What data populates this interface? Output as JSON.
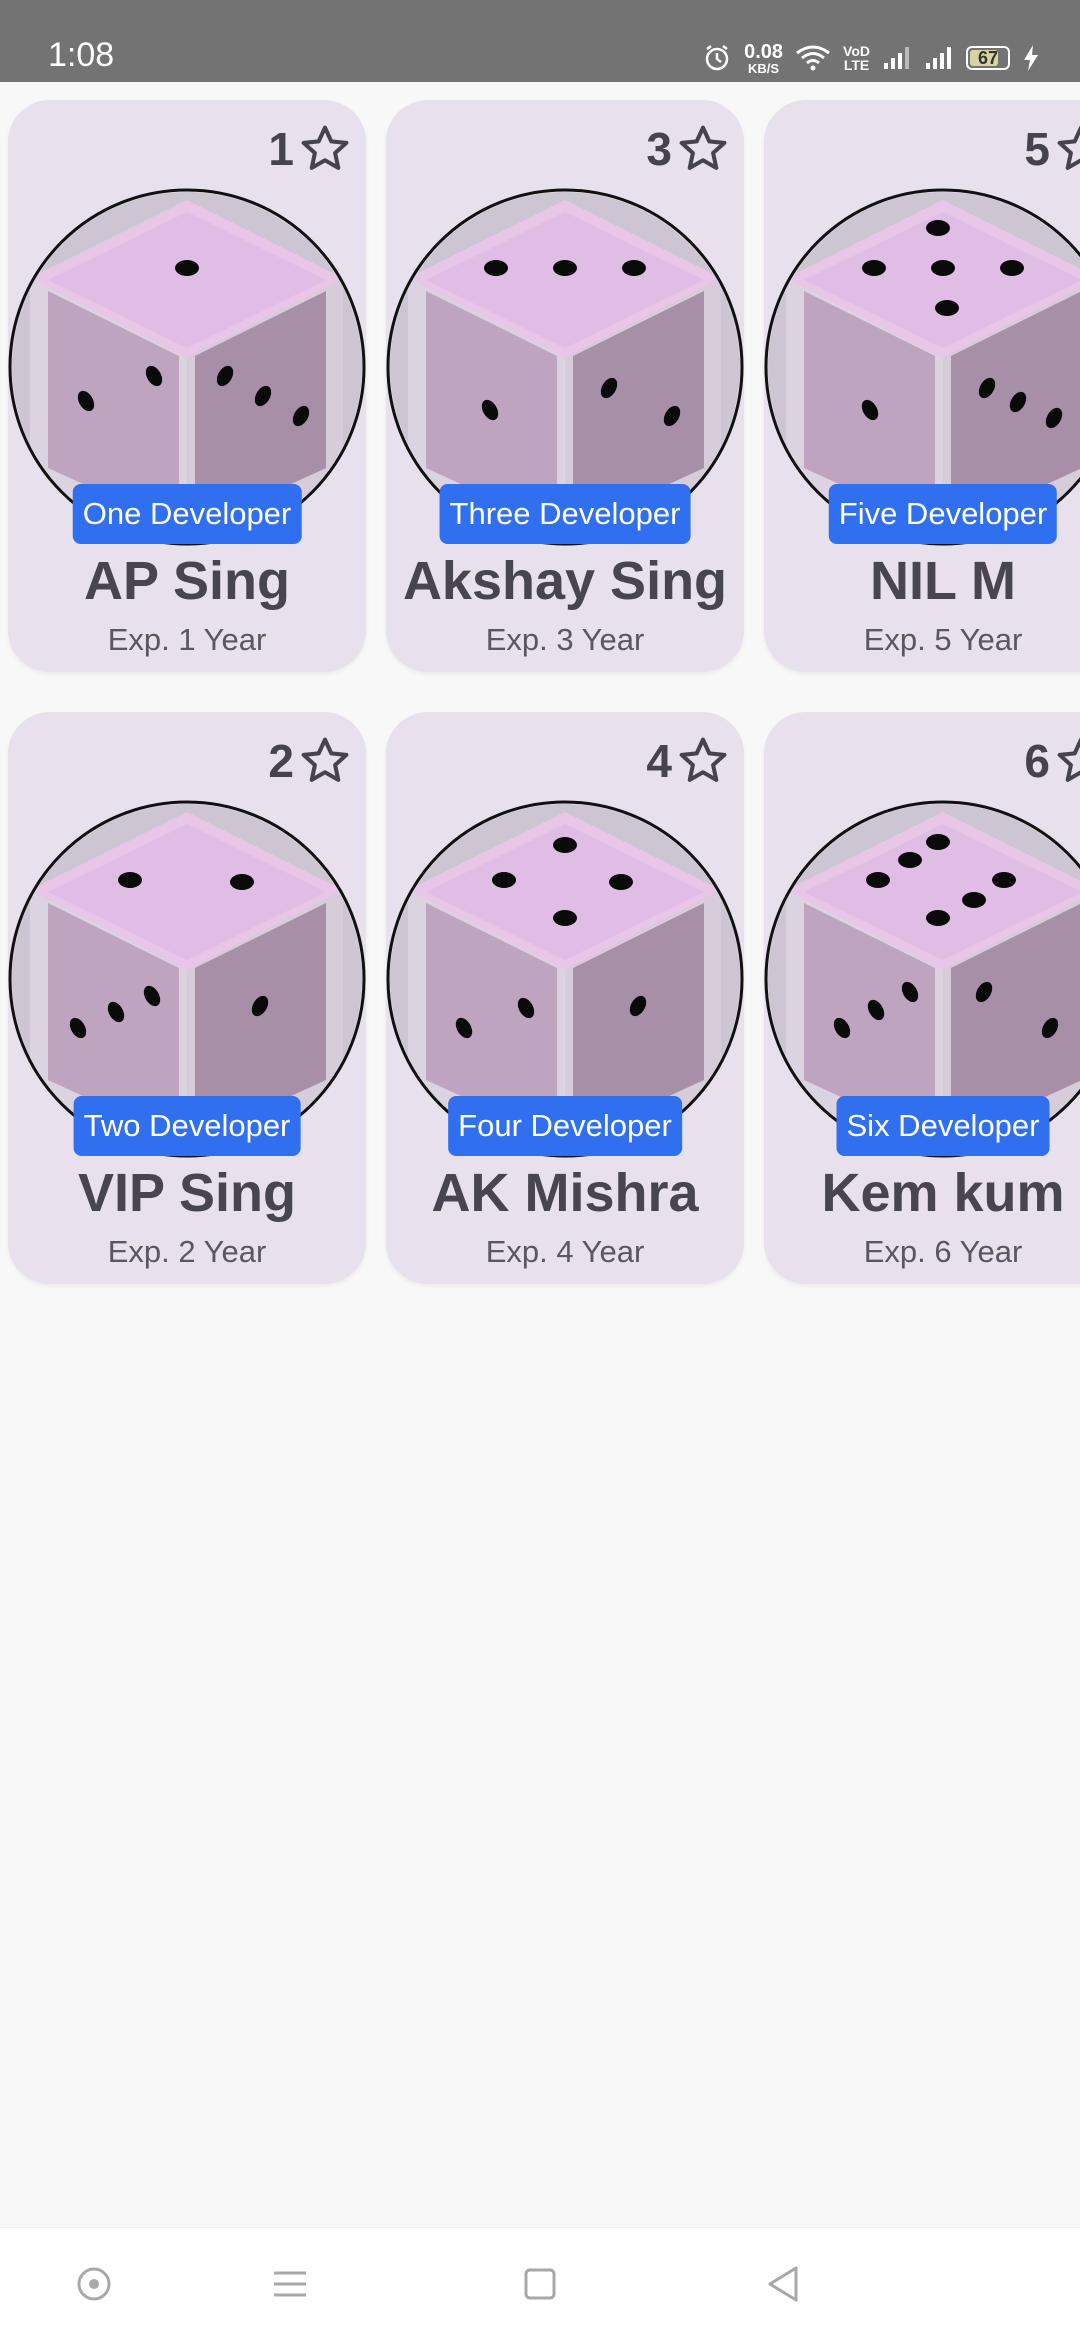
{
  "status_bar": {
    "time": "1:08",
    "net_speed_value": "0.08",
    "net_speed_unit": "KB/S",
    "volte_top": "VoD",
    "volte_bottom": "LTE",
    "battery": "67"
  },
  "cards": [
    {
      "rating": "1",
      "role": "One Developer",
      "name": "AP Sing",
      "exp": "Exp. 1 Year",
      "pips": 1
    },
    {
      "rating": "3",
      "role": "Three Developer",
      "name": "Akshay Sing",
      "exp": "Exp. 3 Year",
      "pips": 3
    },
    {
      "rating": "5",
      "role": "Five Developer",
      "name": "NIL M",
      "exp": "Exp. 5 Year",
      "pips": 5
    },
    {
      "rating": "2",
      "role": "Two Developer",
      "name": "VIP Sing",
      "exp": "Exp. 2 Year",
      "pips": 2
    },
    {
      "rating": "4",
      "role": "Four Developer",
      "name": "AK Mishra",
      "exp": "Exp. 4 Year",
      "pips": 4
    },
    {
      "rating": "6",
      "role": "Six Developer",
      "name": "Kem kum",
      "exp": "Exp. 6 Year",
      "pips": 6
    }
  ],
  "icons": {
    "rating": "star-outline-icon",
    "avatar": "dice-icon",
    "nav": [
      "circle-dot-icon",
      "menu-icon",
      "square-icon",
      "back-triangle-icon"
    ]
  },
  "colors": {
    "badge": "#2f6ff0",
    "card": "#e8e0ec",
    "status_bar": "#737373"
  }
}
